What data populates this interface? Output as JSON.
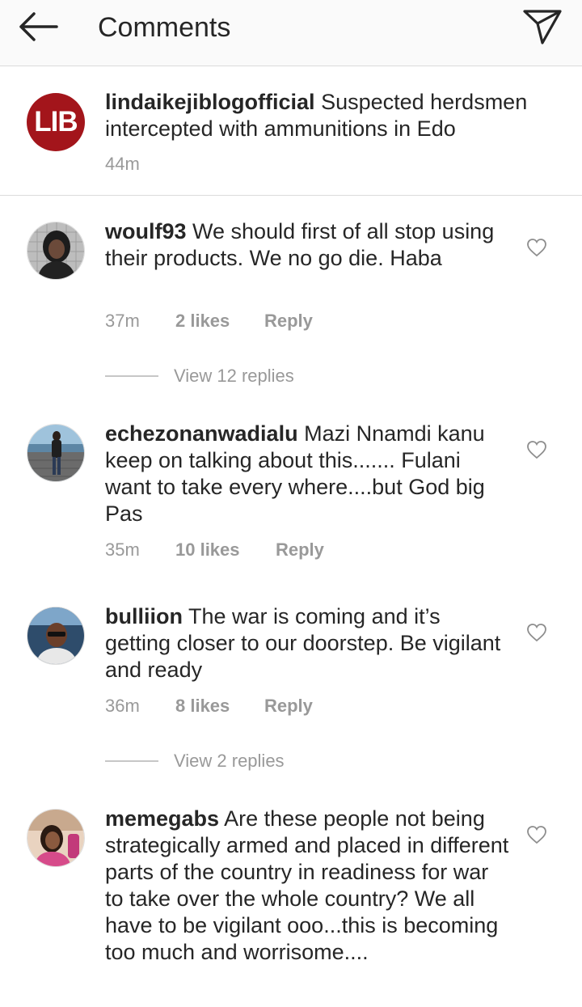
{
  "header": {
    "title": "Comments",
    "back_icon": "arrow-left-icon",
    "share_icon": "direct-send-icon"
  },
  "caption": {
    "username": "lindaikejiblogofficial",
    "logo_text": "LIB",
    "logo_color": "#a3151b",
    "text": "Suspected herdsmen intercepted with ammunitions in Edo",
    "time": "44m"
  },
  "comments": [
    {
      "username": "woulf93",
      "text": "We should first of all stop using their products.  We no go die. Haba",
      "time": "37m",
      "likes": "2 likes",
      "reply": "Reply",
      "view_replies": "View 12 replies"
    },
    {
      "username": "echezonanwadialu",
      "text": "Mazi Nnamdi kanu keep on talking about this....... Fulani want to take every where....but God big Pas",
      "time": "35m",
      "likes": "10 likes",
      "reply": "Reply"
    },
    {
      "username": "bulliion",
      "text": "The war is coming and it’s getting closer to our doorstep. Be vigilant and ready",
      "time": "36m",
      "likes": "8 likes",
      "reply": "Reply",
      "view_replies": "View 2 replies"
    },
    {
      "username": "memegabs",
      "text": "Are these people not being strategically armed and placed in different parts of the country in readiness for war to take over the whole country? We all have to be vigilant ooo...this is becoming too much and worrisome...."
    }
  ],
  "colors": {
    "secondary_text": "#999999",
    "primary_text": "#262626",
    "divider": "#dbdbdb"
  }
}
